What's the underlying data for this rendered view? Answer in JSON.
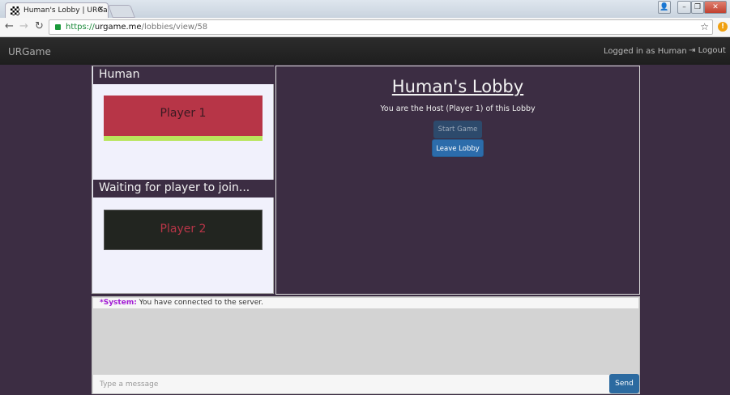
{
  "browser": {
    "tab_title": "Human's Lobby | URGame",
    "url_scheme": "https://",
    "url_host": "urgame.me",
    "url_path": "/lobbies/view/58"
  },
  "navbar": {
    "brand": "URGame",
    "logged_in": "Logged in as Human",
    "logout": "Logout"
  },
  "left_panel": {
    "host_header": "Human",
    "player1": "Player 1",
    "waiting_header": "Waiting for player to join...",
    "player2": "Player 2"
  },
  "lobby": {
    "title": "Human's Lobby",
    "subtitle": "You are the Host (Player 1) of this Lobby",
    "start_game": "Start Game",
    "leave_lobby": "Leave Lobby"
  },
  "chat": {
    "messages": [
      {
        "sender": "*System:",
        "text": " You have connected to the server."
      }
    ],
    "placeholder": "Type a message",
    "send": "Send"
  },
  "colors": {
    "background": "#3c2d43",
    "player1": "#b73547",
    "ready_bar": "#b9e55c",
    "primary": "#2c6cab",
    "system": "#a21ad4"
  }
}
